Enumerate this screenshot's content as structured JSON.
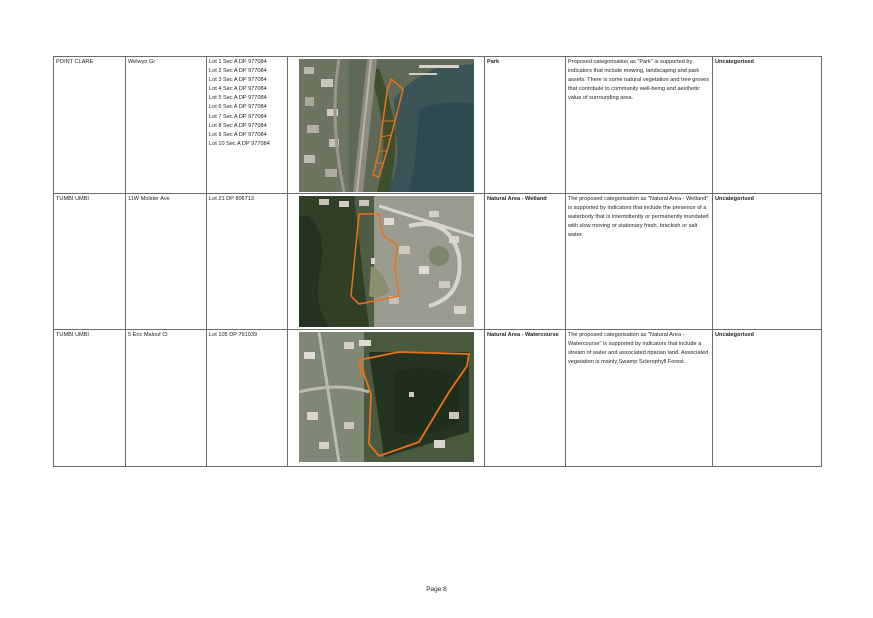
{
  "rows": [
    {
      "suburb": "POINT CLARE",
      "address": "Welwyn Gr",
      "lots": [
        "Lot 1 Sec A DP 977084",
        "Lot 2 Sec A DP 977084",
        "Lot 3 Sec A DP 977084",
        "Lot 4 Sec A DP 977084",
        "Lot 5 Sec A DP 977084",
        "Lot 6 Sec A DP 977084",
        "Lot 7 Sec A DP 977084",
        "Lot 8 Sec A DP 977084",
        "Lot 9 Sec A DP 977084",
        "Lot 10 Sec A DP 977084"
      ],
      "image_alt": "aerial photo - Point Clare park parcels",
      "category": "Park",
      "description": "Proposed categorisation as \"Park\" is supported by indicators that include mowing, landscaping and park assets. There is some natural vegetation and tree groves that contribute to community well-being and aesthetic value of surrounding area.",
      "current": "Uncategorised"
    },
    {
      "suburb": "TUMBI UMBI",
      "address": "11W Molster Ave",
      "lots": [
        "Lot 21 DP 806713"
      ],
      "image_alt": "aerial photo - Tumbi Umbi wetland parcel",
      "category": "Natural Area - Wetland",
      "description": "The proposed categorisation as \"Natural Area - Wetland\" is supported by indicators that include the presence of a waterbody that is intermittently or permanently inundated with slow moving or stationary fresh, brackish or salt water.",
      "current": "Uncategorised"
    },
    {
      "suburb": "TUMBI UMBI",
      "address": "5 Eric Malouf Cl",
      "lots": [
        "Lot 105 DP 791039"
      ],
      "image_alt": "aerial photo - Tumbi Umbi watercourse parcel",
      "category": "Natural Area - Watercourse",
      "description": "The proposed categorisation as \"Natural Area - Watercourse\" is supported by indicators that include a stream of water and associated riparian land. Associated vegetation is mainly Swamp Sclerophyll Forest.",
      "current": "Uncategorised"
    }
  ],
  "footer": {
    "page_label": "Page 8"
  }
}
